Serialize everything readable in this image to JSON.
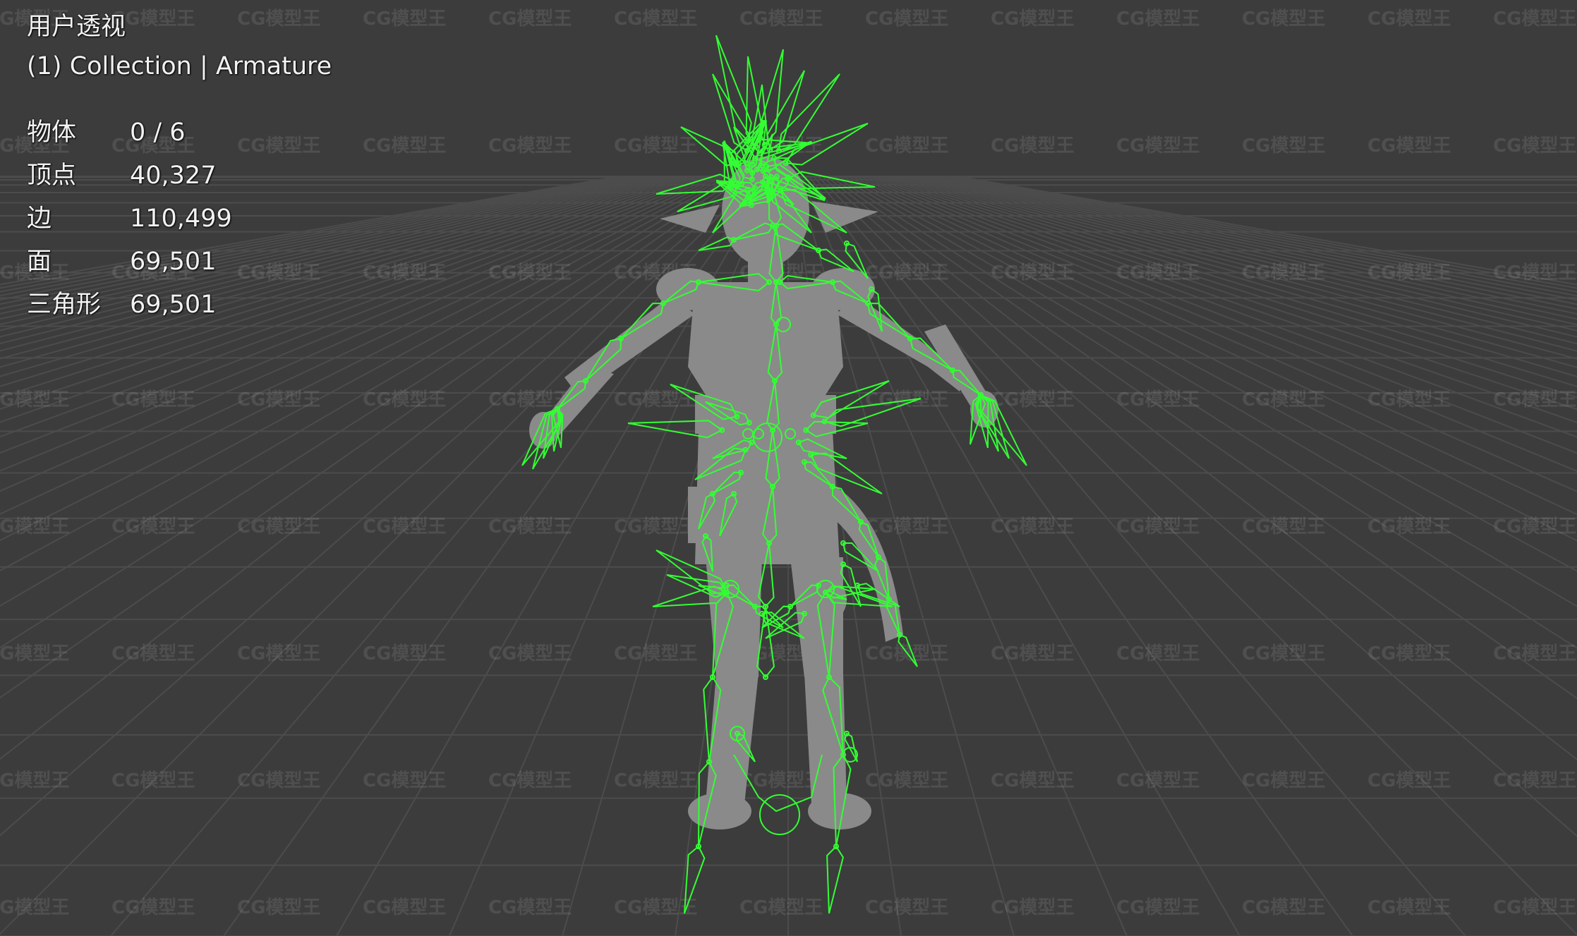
{
  "viewport": {
    "view_name": "用户透视",
    "collection_line": "(1) Collection | Armature"
  },
  "stats": [
    {
      "label": "物体",
      "value": "0 / 6"
    },
    {
      "label": "顶点",
      "value": "40,327"
    },
    {
      "label": "边",
      "value": "110,499"
    },
    {
      "label": "面",
      "value": "69,501"
    },
    {
      "label": "三角形",
      "value": "69,501"
    }
  ],
  "watermark_text": "CG模型王",
  "colors": {
    "background": "#3c3c3c",
    "grid": "#4c4c4c",
    "mesh": "#8a8a8a",
    "armature": "#33ff33"
  }
}
